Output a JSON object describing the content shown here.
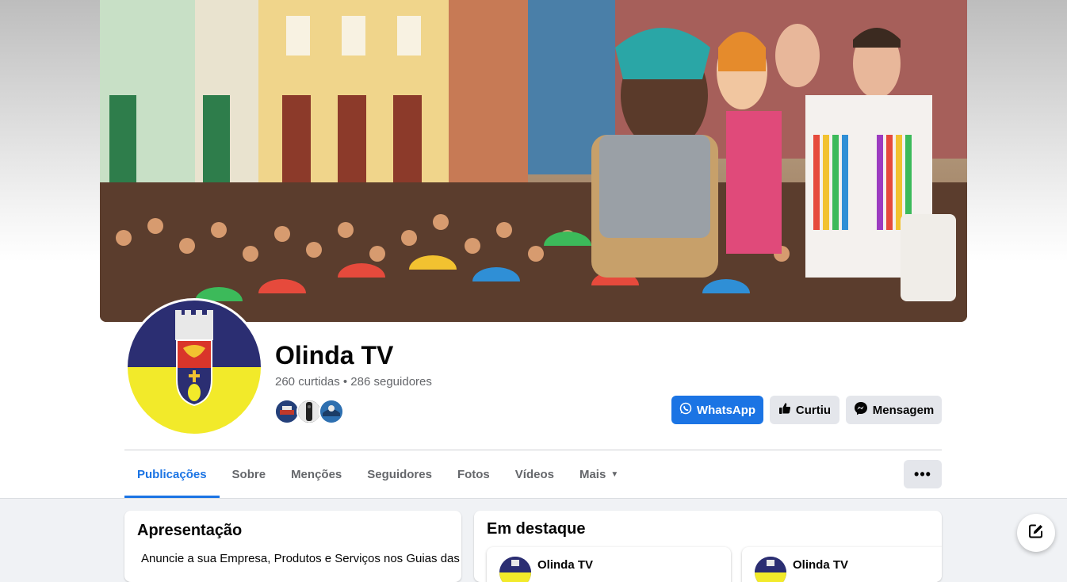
{
  "page": {
    "name": "Olinda TV",
    "stats": "260 curtidas • 286 seguidores"
  },
  "actions": {
    "whatsapp_label": "WhatsApp",
    "liked_label": "Curtiu",
    "message_label": "Mensagem"
  },
  "tabs": [
    {
      "label": "Publicações",
      "active": true
    },
    {
      "label": "Sobre"
    },
    {
      "label": "Menções"
    },
    {
      "label": "Seguidores"
    },
    {
      "label": "Fotos"
    },
    {
      "label": "Vídeos"
    },
    {
      "label": "Mais"
    }
  ],
  "more_options_icon": "ellipsis-icon",
  "intro": {
    "title": "Apresentação",
    "text": "Anuncie a sua Empresa, Produtos e Serviços nos Guias das"
  },
  "featured": {
    "title": "Em destaque",
    "items": [
      {
        "name": "Olinda TV"
      },
      {
        "name": "Olinda TV"
      }
    ]
  },
  "colors": {
    "accent": "#1b74e4",
    "whatsapp_button": "#1b74e4",
    "neutral_button": "#e4e6eb",
    "flag_blue": "#2b2e72",
    "flag_yellow": "#f2ea2a"
  }
}
